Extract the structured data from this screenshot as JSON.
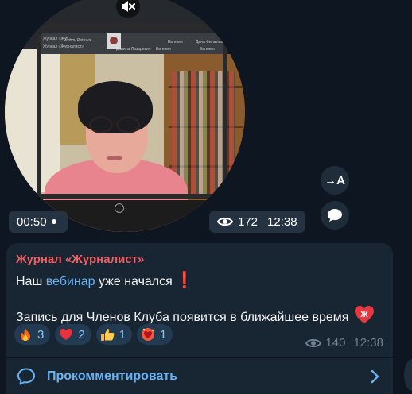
{
  "video": {
    "duration": "00:50",
    "views": "172",
    "time": "12:38",
    "icons": {
      "mute": "mute-speaker-icon",
      "views": "eye-icon"
    },
    "screen_labels": [
      "Журнал «Жур...",
      "Журнал «Журналист»",
      "Lubov Petrova",
      "Данила Лазаревич",
      "Евгения",
      "Евгения",
      "Дина Филатова",
      "Евгения"
    ]
  },
  "side_actions": {
    "translate_label": "→A",
    "icons": {
      "translate": "translate-icon",
      "comment": "comment-bubble-icon"
    }
  },
  "message": {
    "sender": "Журнал «Журналист»",
    "line1_prefix": "Наш ",
    "line1_link": "вебинар",
    "line1_suffix": " уже начался",
    "exclaim": "❗",
    "line2": "Запись для Членов Клуба появится в ближайшее время",
    "heart_badge_letter": "Ж",
    "reactions": [
      {
        "emoji": "fire-icon",
        "count": "3"
      },
      {
        "emoji": "red-heart-icon",
        "count": "2"
      },
      {
        "emoji": "thumbs-up-icon",
        "count": "1"
      },
      {
        "emoji": "heart-exclamation-icon",
        "count": "1"
      }
    ],
    "views": "140",
    "time": "12:38",
    "comment_label": "Прокомментировать"
  },
  "colors": {
    "background": "#0e1621",
    "bubble": "#182533",
    "sender": "#ee5f64",
    "link": "#6ab3f3",
    "reaction_bg": "#223a52",
    "meta": "#6d7f90"
  }
}
